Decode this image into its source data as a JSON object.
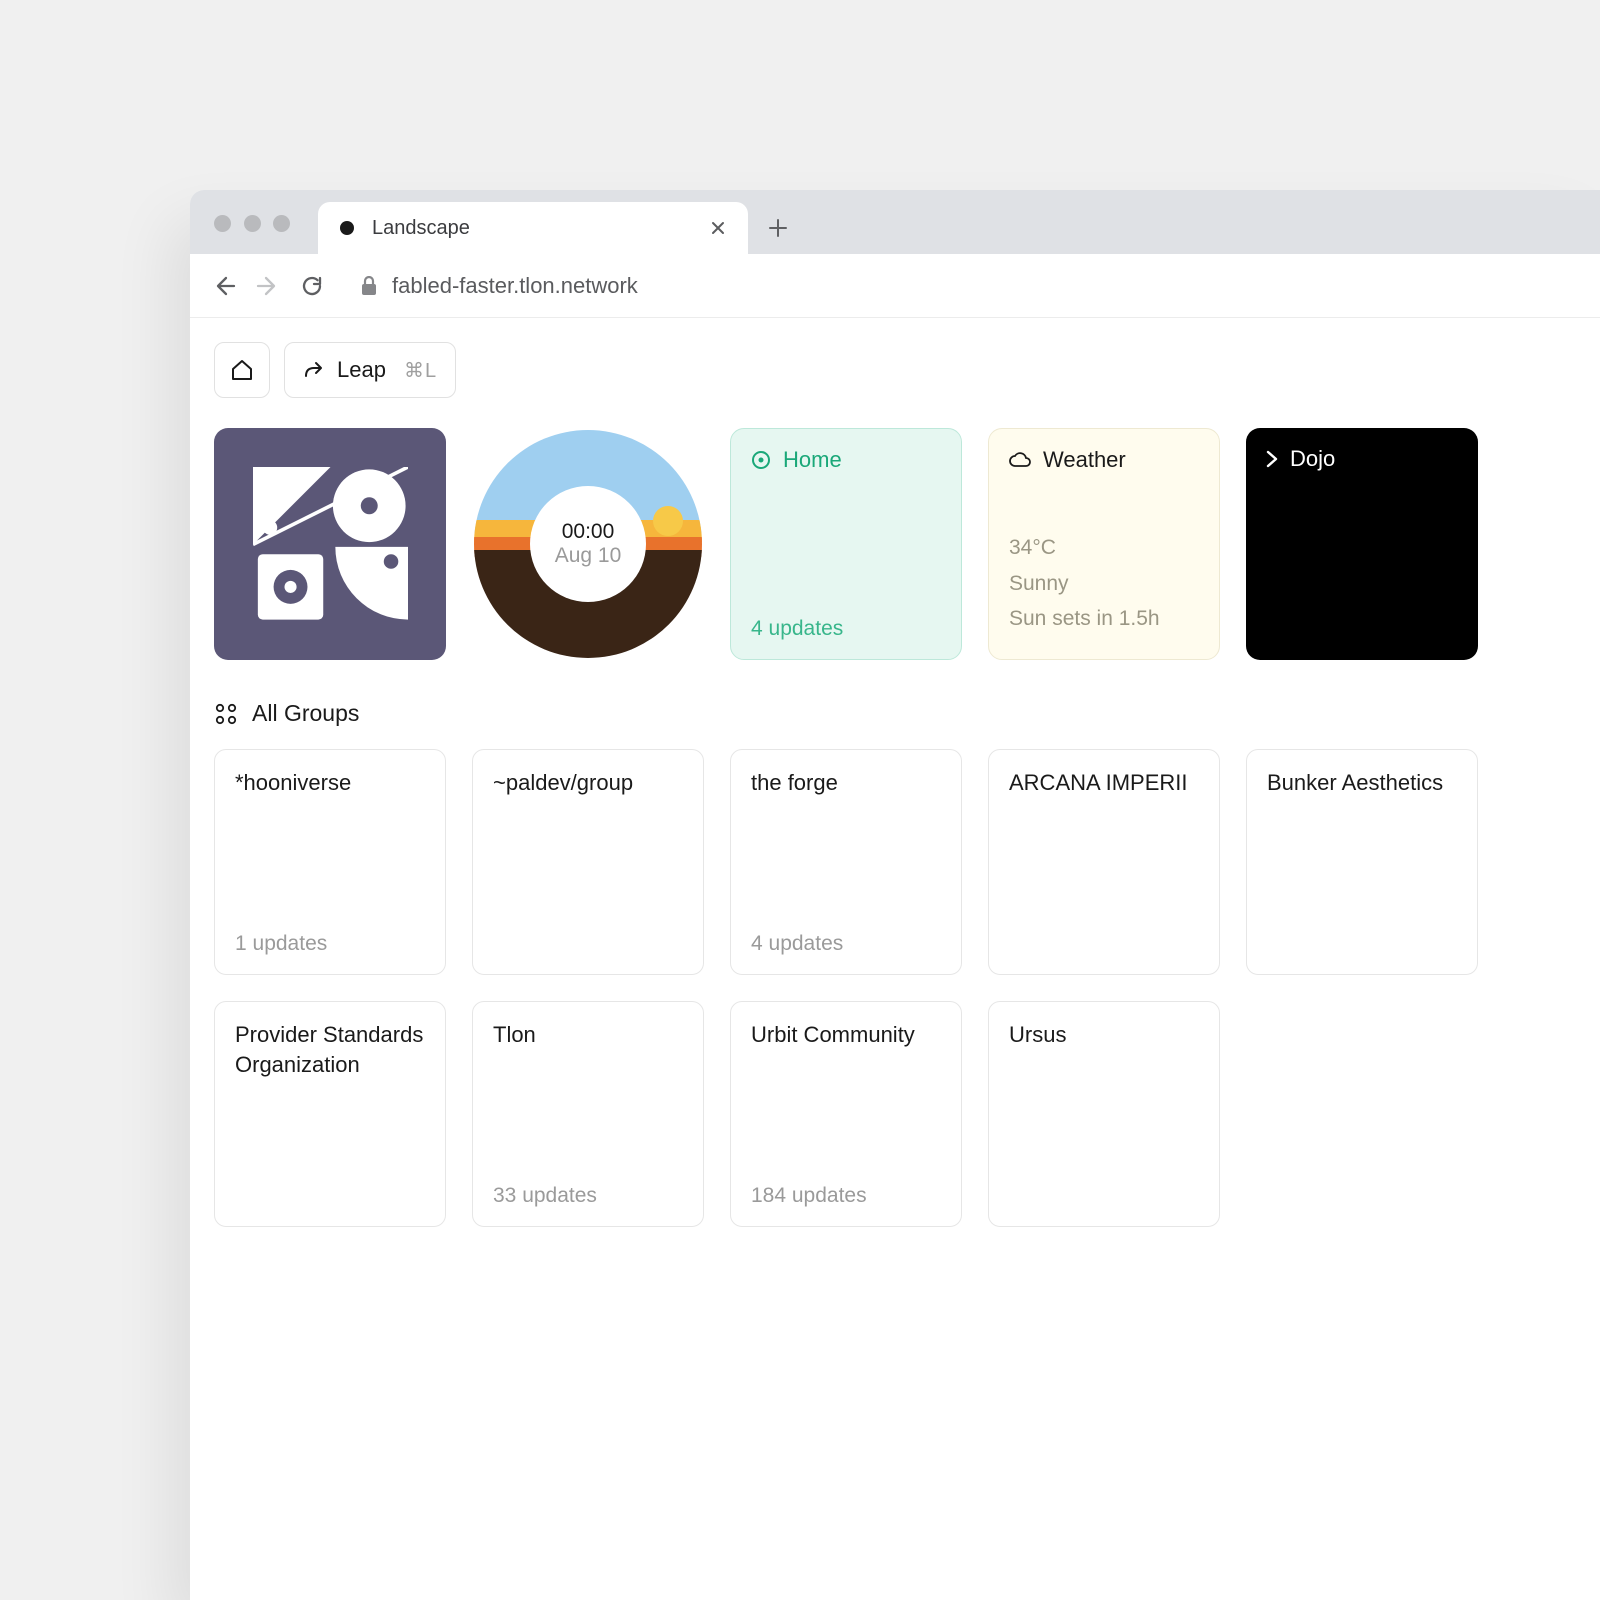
{
  "browser": {
    "tab_title": "Landscape",
    "url": "fabled-faster.tlon.network"
  },
  "toolbar": {
    "leap_label": "Leap",
    "leap_shortcut": "⌘L"
  },
  "clock": {
    "time": "00:00",
    "date": "Aug 10"
  },
  "home": {
    "title": "Home",
    "updates": "4 updates"
  },
  "weather": {
    "title": "Weather",
    "temp": "34°C",
    "condition": "Sunny",
    "sunset": "Sun sets in 1.5h"
  },
  "dojo": {
    "title": "Dojo"
  },
  "section": {
    "all_groups": "All Groups"
  },
  "groups": [
    {
      "name": "*hooniverse",
      "updates": "1 updates"
    },
    {
      "name": "~paldev/group",
      "updates": ""
    },
    {
      "name": "the forge",
      "updates": "4 updates"
    },
    {
      "name": "ARCANA IMPERII",
      "updates": ""
    },
    {
      "name": "Bunker Aesthetics",
      "updates": ""
    },
    {
      "name": "Provider Standards Organization",
      "updates": ""
    },
    {
      "name": "Tlon",
      "updates": "33 updates"
    },
    {
      "name": "Urbit Community",
      "updates": "184 updates"
    },
    {
      "name": "Ursus",
      "updates": ""
    }
  ]
}
